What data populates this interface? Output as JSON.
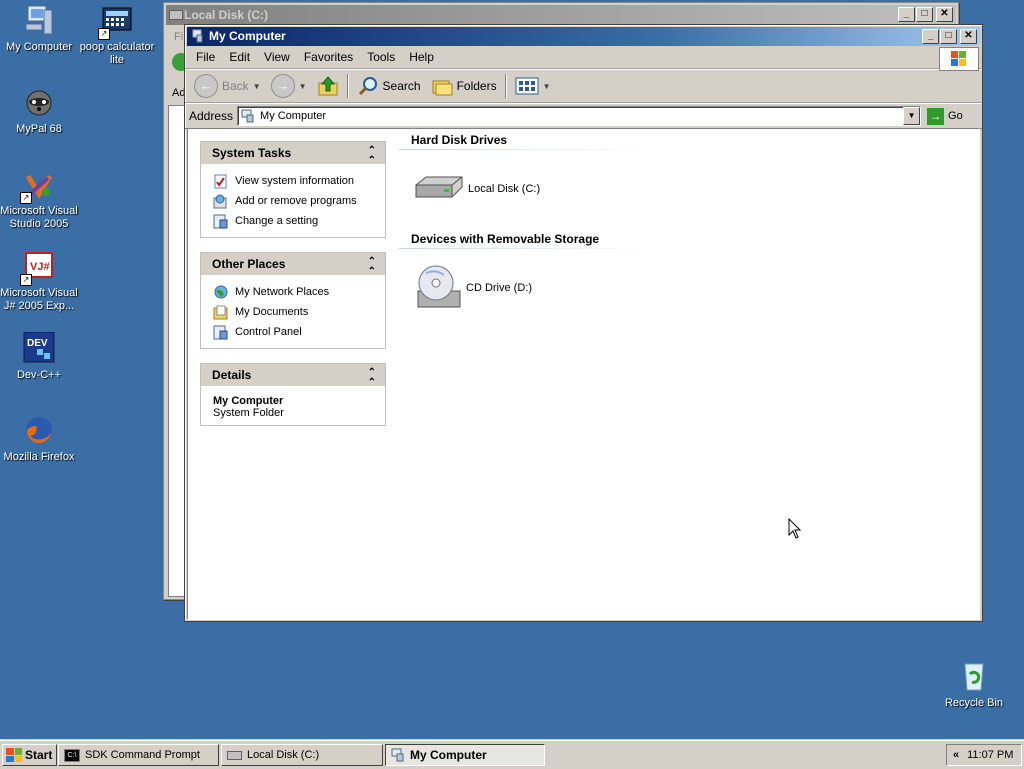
{
  "desktop": {
    "icons": [
      {
        "label": "My Computer"
      },
      {
        "label": "poop calculator lite"
      },
      {
        "label": "MyPal 68"
      },
      {
        "label": "Microsoft Visual Studio 2005"
      },
      {
        "label": "Microsoft Visual J# 2005 Exp..."
      },
      {
        "label": "Dev-C++"
      },
      {
        "label": "Mozilla Firefox"
      },
      {
        "label": "Recycle Bin"
      }
    ]
  },
  "back_window": {
    "title": "Local Disk (C:)",
    "menu_hint": "Fi",
    "address_hint": "Ad"
  },
  "window": {
    "title": "My Computer",
    "menu": [
      "File",
      "Edit",
      "View",
      "Favorites",
      "Tools",
      "Help"
    ],
    "toolbar": {
      "back": "Back",
      "search": "Search",
      "folders": "Folders"
    },
    "address": {
      "label": "Address",
      "value": "My Computer",
      "go": "Go"
    },
    "tasks": {
      "system": {
        "title": "System Tasks",
        "links": [
          "View system information",
          "Add or remove programs",
          "Change a setting"
        ]
      },
      "other": {
        "title": "Other Places",
        "links": [
          "My Network Places",
          "My Documents",
          "Control Panel"
        ]
      },
      "details": {
        "title": "Details",
        "name": "My Computer",
        "type": "System Folder"
      }
    },
    "sections": [
      {
        "title": "Hard Disk Drives",
        "items": [
          "Local Disk (C:)"
        ]
      },
      {
        "title": "Devices with Removable Storage",
        "items": [
          "CD Drive (D:)"
        ]
      }
    ]
  },
  "taskbar": {
    "start": "Start",
    "tasks": [
      "SDK Command Prompt",
      "Local Disk (C:)",
      "My Computer"
    ],
    "clock": "11:07 PM",
    "tray_chevron": "«"
  }
}
